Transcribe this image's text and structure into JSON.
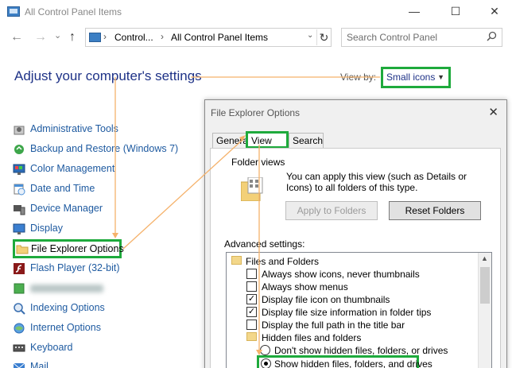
{
  "window": {
    "title": "All Control Panel Items",
    "minimize": "—",
    "maximize": "☐",
    "close": "✕"
  },
  "nav": {
    "back": "←",
    "forward": "→",
    "recent": "⌄",
    "up": "↑",
    "breadcrumb": [
      "Control...",
      "All Control Panel Items"
    ],
    "refresh": "↻",
    "search_placeholder": "Search Control Panel",
    "search_icon": "⚲"
  },
  "main": {
    "heading": "Adjust your computer's settings",
    "view_by_label": "View by:",
    "view_by_value": "Small icons",
    "items": [
      {
        "label": "Administrative Tools",
        "icon": "admin-tools-icon"
      },
      {
        "label": "Backup and Restore (Windows 7)",
        "icon": "backup-icon"
      },
      {
        "label": "Color Management",
        "icon": "color-management-icon"
      },
      {
        "label": "Date and Time",
        "icon": "date-time-icon"
      },
      {
        "label": "Device Manager",
        "icon": "device-manager-icon"
      },
      {
        "label": "Display",
        "icon": "display-icon"
      },
      {
        "label": "File Explorer Options",
        "icon": "folder-icon"
      },
      {
        "label": "Flash Player (32-bit)",
        "icon": "flash-icon"
      },
      {
        "label": "",
        "icon": "blurred-item-icon"
      },
      {
        "label": "Indexing Options",
        "icon": "indexing-icon"
      },
      {
        "label": "Internet Options",
        "icon": "internet-icon"
      },
      {
        "label": "Keyboard",
        "icon": "keyboard-icon"
      },
      {
        "label": "Mail",
        "icon": "mail-icon"
      }
    ]
  },
  "dialog": {
    "title": "File Explorer Options",
    "close": "✕",
    "tabs": [
      "General",
      "View",
      "Search"
    ],
    "active_tab": "View",
    "folder_views": {
      "title": "Folder views",
      "description": "You can apply this view (such as Details or Icons) to all folders of this type.",
      "apply_button": "Apply to Folders",
      "reset_button": "Reset Folders"
    },
    "advanced_label": "Advanced settings:",
    "advanced": [
      {
        "type": "folder",
        "label": "Files and Folders",
        "indent": 0
      },
      {
        "type": "checkbox",
        "label": "Always show icons, never thumbnails",
        "checked": false,
        "indent": 1
      },
      {
        "type": "checkbox",
        "label": "Always show menus",
        "checked": false,
        "indent": 1
      },
      {
        "type": "checkbox",
        "label": "Display file icon on thumbnails",
        "checked": true,
        "indent": 1
      },
      {
        "type": "checkbox",
        "label": "Display file size information in folder tips",
        "checked": true,
        "indent": 1
      },
      {
        "type": "checkbox",
        "label": "Display the full path in the title bar",
        "checked": false,
        "indent": 1
      },
      {
        "type": "folder",
        "label": "Hidden files and folders",
        "indent": 1
      },
      {
        "type": "radio",
        "label": "Don't show hidden files, folders, or drives",
        "checked": false,
        "indent": 2
      },
      {
        "type": "radio",
        "label": "Show hidden files, folders, and drives",
        "checked": true,
        "indent": 2
      }
    ]
  },
  "colors": {
    "highlight": "#1eaa3c",
    "arrow": "#f5b26b",
    "link": "#1e5aa0",
    "heading": "#1e3287"
  }
}
